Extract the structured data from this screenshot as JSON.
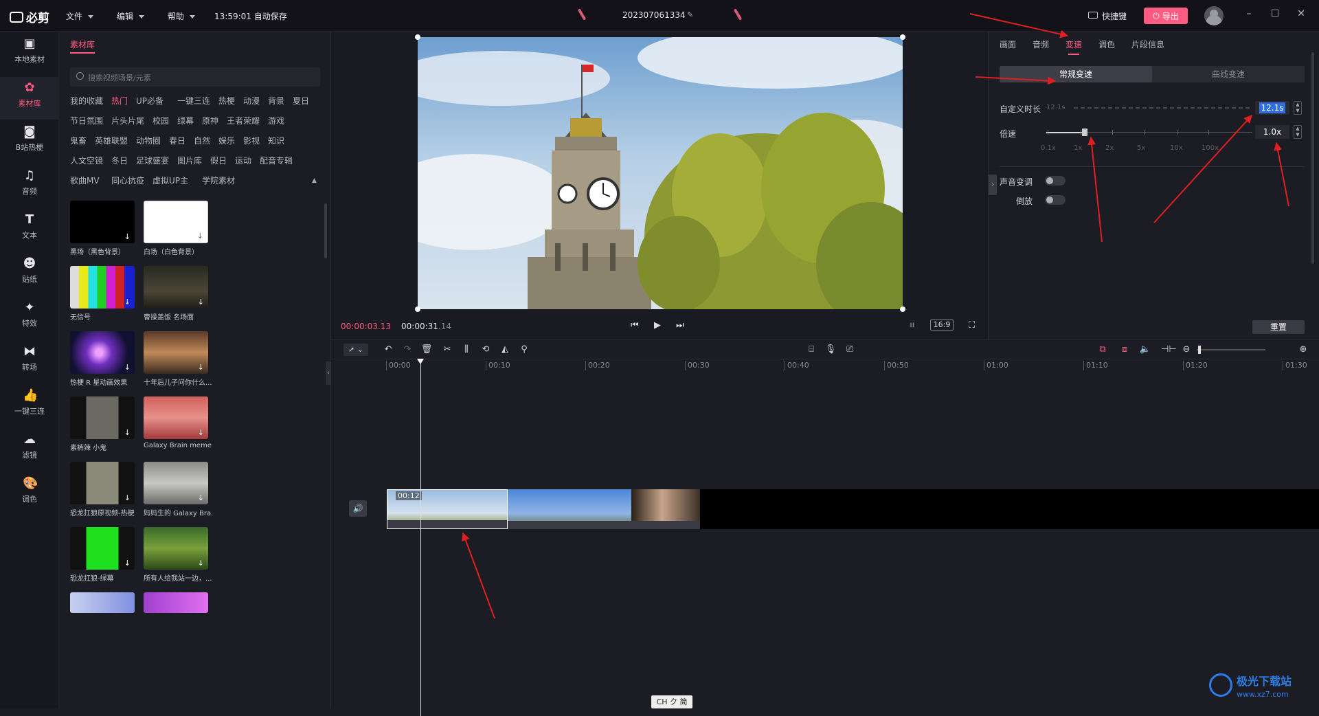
{
  "titlebar": {
    "app_name": "必剪",
    "menus": [
      "文件",
      "编辑",
      "帮助"
    ],
    "autosave": "13:59:01 自动保存",
    "project_name": "202307061334",
    "shortcut_label": "快捷键",
    "export_label": "导出"
  },
  "sidebar": {
    "items": [
      {
        "label": "本地素材",
        "icon": "folder-icon"
      },
      {
        "label": "素材库",
        "icon": "library-icon"
      },
      {
        "label": "B站热梗",
        "icon": "bilibili-icon"
      },
      {
        "label": "音频",
        "icon": "music-icon"
      },
      {
        "label": "文本",
        "icon": "text-icon"
      },
      {
        "label": "贴纸",
        "icon": "sticker-icon"
      },
      {
        "label": "特效",
        "icon": "effect-icon"
      },
      {
        "label": "转场",
        "icon": "transition-icon"
      },
      {
        "label": "一键三连",
        "icon": "like-icon"
      },
      {
        "label": "滤镜",
        "icon": "filter-icon"
      },
      {
        "label": "调色",
        "icon": "palette-icon"
      }
    ]
  },
  "library": {
    "tab": "素材库",
    "search_placeholder": "搜索视频场景/元素",
    "tags_rows": [
      [
        "我的收藏",
        "热门",
        "UP必备",
        "一键三连",
        "热梗",
        "动漫",
        "背景",
        "夏日"
      ],
      [
        "节日氛围",
        "片头片尾",
        "校园",
        "绿幕",
        "原神",
        "王者荣耀",
        "游戏"
      ],
      [
        "鬼畜",
        "英雄联盟",
        "动物圈",
        "春日",
        "自然",
        "娱乐",
        "影视",
        "知识"
      ],
      [
        "人文空镜",
        "冬日",
        "足球盛宴",
        "图片库",
        "假日",
        "运动",
        "配音专辑"
      ],
      [
        "歌曲MV",
        "同心抗疫",
        "虚拟UP主",
        "学院素材"
      ]
    ],
    "items": [
      {
        "caption": "黑场（黑色背景）"
      },
      {
        "caption": "白场（白色背景）"
      },
      {
        "caption": "无信号"
      },
      {
        "caption": "曹操盖饭 名场面"
      },
      {
        "caption": "热梗 R 星动画效果"
      },
      {
        "caption": "十年后儿子问你什么..."
      },
      {
        "caption": "素裤辣 小鬼"
      },
      {
        "caption": "Galaxy Brain meme ..."
      },
      {
        "caption": "恐龙扛狼原视频-热梗"
      },
      {
        "caption": "妈妈生的 Galaxy Bra..."
      },
      {
        "caption": "恐龙扛狼-绿幕"
      },
      {
        "caption": "所有人给我站一边，..."
      }
    ]
  },
  "preview": {
    "current_time": "00:00:03.13",
    "total_time_main": "00:00:31",
    "total_time_frac": ".14",
    "ratio": "16:9"
  },
  "right_panel": {
    "tabs": [
      "画面",
      "音频",
      "变速",
      "调色",
      "片段信息"
    ],
    "active_tab": "变速",
    "mode_normal": "常规变速",
    "mode_curve": "曲线变速",
    "duration_label": "自定义时长",
    "duration_hint": "12.1s",
    "duration_value": "12.1s",
    "speed_label": "倍速",
    "speed_value": "1.0x",
    "speed_ticks": [
      "0.1x",
      "1x",
      "2x",
      "5x",
      "10x",
      "100x"
    ],
    "pitch_label": "声音变调",
    "reverse_label": "倒放",
    "reset_label": "重置"
  },
  "timeline": {
    "ruler": [
      "00:00",
      "00:10",
      "00:20",
      "00:30",
      "00:40",
      "00:50",
      "01:00",
      "01:10",
      "01:20",
      "01:30"
    ],
    "clip_label": "00:12"
  },
  "status": {
    "ime": "CH ク 简"
  },
  "watermark": {
    "name": "极光下载站",
    "url": "www.xz7.com"
  },
  "colors": {
    "accent": "#ff5a82",
    "annotation": "#e02020"
  }
}
